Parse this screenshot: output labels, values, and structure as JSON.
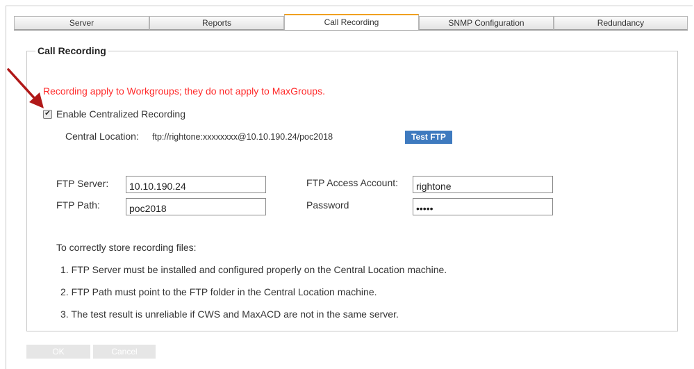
{
  "tabs": [
    {
      "label": "Server",
      "active": false
    },
    {
      "label": "Reports",
      "active": false
    },
    {
      "label": "Call Recording",
      "active": true
    },
    {
      "label": "SNMP Configuration",
      "active": false
    },
    {
      "label": "Redundancy",
      "active": false
    }
  ],
  "section": {
    "title": "Call Recording"
  },
  "warning": "Recording apply to Workgroups; they do not apply to MaxGroups.",
  "enable_recording": {
    "label": "Enable Centralized Recording",
    "checked": true
  },
  "central_location": {
    "label": "Central Location:",
    "value": "ftp://rightone:xxxxxxxx@10.10.190.24/poc2018"
  },
  "test_ftp_button": "Test FTP",
  "ftp_server": {
    "label": "FTP Server:",
    "value": "10.10.190.24"
  },
  "ftp_path": {
    "label": "FTP Path:",
    "value": "poc2018"
  },
  "ftp_account": {
    "label": "FTP Access Account:",
    "value": "rightone"
  },
  "password": {
    "label": "Password",
    "value": "•••••"
  },
  "notes": {
    "intro": "To correctly store recording files:",
    "items": [
      "1. FTP Server must be installed and configured properly on the Central Location machine.",
      "2. FTP Path must point to the FTP folder in the Central Location machine.",
      "3. The test result is unreliable if CWS and MaxACD are not in the same server."
    ]
  },
  "buttons": {
    "ok": "OK",
    "cancel": "Cancel"
  },
  "colors": {
    "warning": "#ff2a2a",
    "accent_tab": "#f0a020",
    "button_blue": "#3e7abf",
    "arrow": "#b01818"
  }
}
